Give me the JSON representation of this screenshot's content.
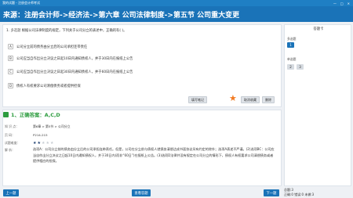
{
  "window": {
    "title": "我的试题 - 注册会计师考试",
    "controls": [
      "—",
      "□",
      "✕"
    ]
  },
  "header": {
    "breadcrumb": "来源：注册会计师->经济法->第六章 公司法律制度->第五节 公司重大变更"
  },
  "question": {
    "number": "1.",
    "type": "多选题",
    "text": "根据公司法律制度的规定，下列关于公司分立的表述中，正确的有(    )。",
    "options": [
      {
        "letter": "A",
        "text": "公司分立前的债务由分立后的公司承担连带责任"
      },
      {
        "letter": "B",
        "text": "公司应当自作出分立决议之日起10日内通知债权人，并于30日内在报纸上公告"
      },
      {
        "letter": "C",
        "text": "公司应当自作出分立决议之日起30日内通知债权人，并于60日内在报纸上公告"
      },
      {
        "letter": "D",
        "text": "债权人有权要求公司清偿债务或者提供担保"
      }
    ],
    "buttons": {
      "note": "填写笔记",
      "cancel_fav": "取消收藏",
      "delete": "删除"
    }
  },
  "answer_card": {
    "title": "答题卡",
    "sections": [
      {
        "label": "多选题",
        "numbers": [
          "1"
        ]
      },
      {
        "label": "单选题",
        "numbers": [
          "2",
          "3"
        ]
      }
    ]
  },
  "answer": {
    "title": "1、正确答案：A,C,D",
    "rows": [
      {
        "label": "知  识  点：",
        "value": "第6章 > 第5节 > 公司分立"
      },
      {
        "label": "页        码：",
        "value": "P214-215"
      },
      {
        "label": "试题难度：",
        "value": ""
      },
      {
        "label": "解        析：",
        "value": ""
      }
    ],
    "difficulty": 2,
    "difficulty_max": 5,
    "explanation": "选项A：公司分立前的债务由分立后的公司承担连带责任。但是，公司在分立前与债权人就债务清偿达成书面协议另有约定的除外；选项A表述不严谨。(2)选项BC：公司应当自作出分立决议之日起10日内通知债权人，并于30日内(而非“60日”)在报纸上公告。(3)选项D法律并没有规定在公司分立的情形下，债权人有权要求公司清偿债务或者提供相应的担保。"
  },
  "footer": {
    "prev": "上一题",
    "view_answer": "查看答题",
    "next": "下一题",
    "stats": [
      "总题:3",
      "正确:0 错误:0 未做:3"
    ]
  },
  "colors": {
    "primary": "#1a73b8",
    "correct": "#2d9c3f",
    "star": "#f27a21"
  }
}
